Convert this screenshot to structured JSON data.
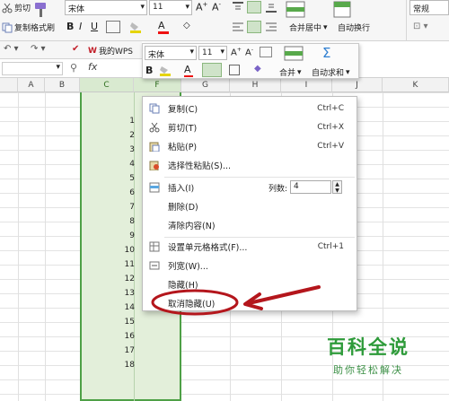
{
  "ribbon": {
    "cut_label": "剪切",
    "copy_label": "复制",
    "format_painter_label": "格式刷",
    "font_name": "宋体",
    "font_size": "11",
    "merge_center_label": "合并居中",
    "wrap_text_label": "自动换行",
    "number_format": "常规",
    "wps_label": "我的WPS"
  },
  "formula_bar": {
    "fx_label": "fx"
  },
  "mini_toolbar": {
    "font_name": "宋体",
    "font_size": "11",
    "merge_label": "合并",
    "autosum_label": "自动求和"
  },
  "columns": [
    "A",
    "B",
    "C",
    "F",
    "G",
    "H",
    "I",
    "J",
    "K"
  ],
  "row_numbers": [
    "1",
    "2",
    "3",
    "4",
    "5",
    "6",
    "7",
    "8",
    "9",
    "10",
    "11",
    "12",
    "13",
    "14",
    "15",
    "16",
    "17",
    "18"
  ],
  "context_menu": {
    "items": [
      {
        "label": "复制(C)",
        "shortcut": "Ctrl+C",
        "icon": "copy-icon"
      },
      {
        "label": "剪切(T)",
        "shortcut": "Ctrl+X",
        "icon": "scissors-icon"
      },
      {
        "label": "粘贴(P)",
        "shortcut": "Ctrl+V",
        "icon": "paste-icon"
      },
      {
        "label": "选择性粘贴(S)...",
        "shortcut": "",
        "icon": "paste-special-icon"
      },
      {
        "label": "插入(I)",
        "shortcut": "",
        "icon": "insert-icon"
      },
      {
        "label": "删除(D)",
        "shortcut": "",
        "icon": ""
      },
      {
        "label": "清除内容(N)",
        "shortcut": "",
        "icon": ""
      },
      {
        "label": "设置单元格格式(F)...",
        "shortcut": "Ctrl+1",
        "icon": "format-cells-icon"
      },
      {
        "label": "列宽(W)...",
        "shortcut": "",
        "icon": "column-width-icon"
      },
      {
        "label": "隐藏(H)",
        "shortcut": "",
        "icon": ""
      },
      {
        "label": "取消隐藏(U)",
        "shortcut": "",
        "icon": ""
      }
    ],
    "columns_count_label": "列数:",
    "columns_count_value": "4"
  },
  "watermark": {
    "title": "百科全说",
    "subtitle": "助你轻松解决"
  },
  "colors": {
    "selection_fill": "#e3efda",
    "selection_border": "#4ea046",
    "annotation_red": "#b4161c",
    "watermark_green": "#2e9b3a"
  }
}
